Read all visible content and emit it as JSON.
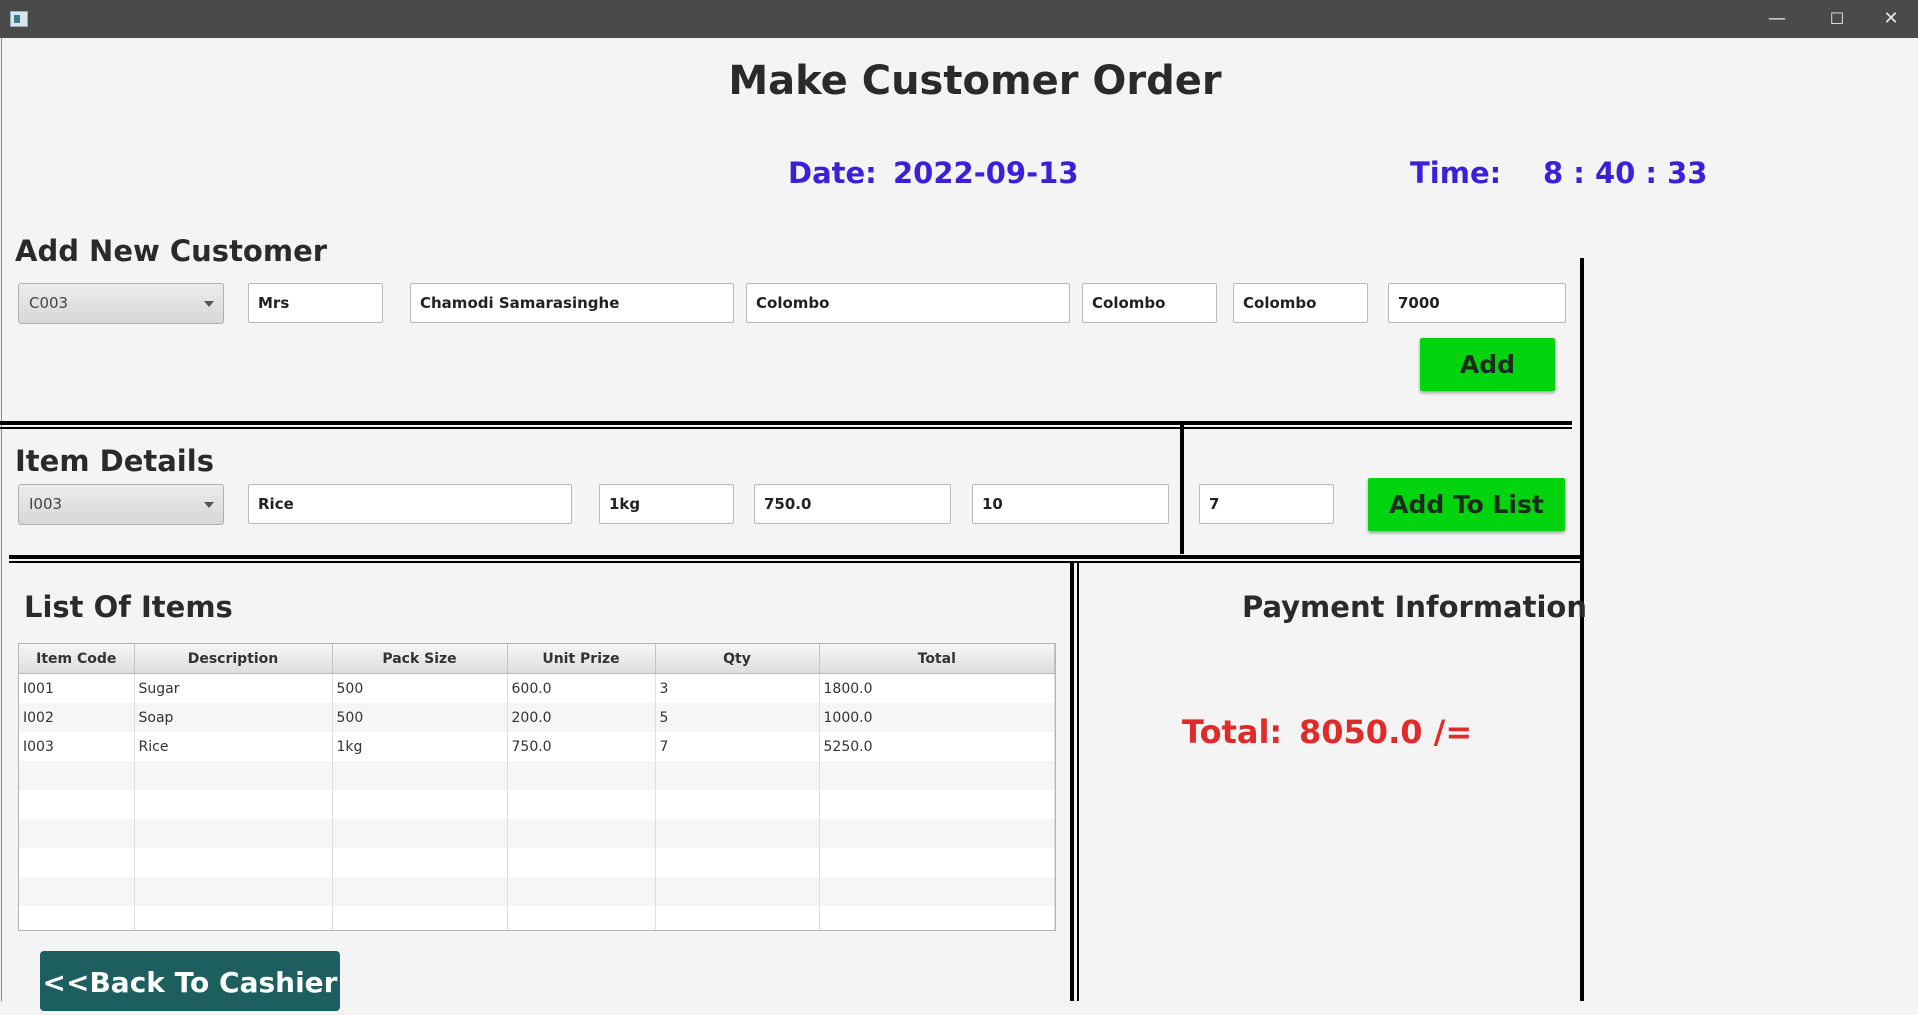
{
  "window": {
    "minimize_glyph": "—",
    "maximize_glyph": "☐",
    "close_glyph": "✕"
  },
  "page_title": "Make Customer Order",
  "date": {
    "label": "Date:",
    "value": "2022-09-13"
  },
  "time": {
    "label": "Time:",
    "value": "8 : 40 : 33"
  },
  "customer": {
    "heading": "Add New Customer",
    "id_selected": "C003",
    "title": "Mrs",
    "name": "Chamodi Samarasinghe",
    "address": "Colombo",
    "city": "Colombo",
    "province": "Colombo",
    "postal_code": "7000",
    "add_label": "Add"
  },
  "item": {
    "heading": "Item Details",
    "code_selected": "I003",
    "description": "Rice",
    "pack_size": "1kg",
    "unit_price": "750.0",
    "qty_on_hand": "10",
    "qty": "7",
    "add_to_list_label": "Add To List"
  },
  "list": {
    "heading": "List Of Items",
    "columns": [
      "Item Code",
      "Description",
      "Pack Size",
      "Unit Prize",
      "Qty",
      "Total"
    ],
    "rows": [
      [
        "I001",
        "Sugar",
        "500",
        "600.0",
        "3",
        "1800.0"
      ],
      [
        "I002",
        "Soap",
        "500",
        "200.0",
        "5",
        "1000.0"
      ],
      [
        "I003",
        "Rice",
        "1kg",
        "750.0",
        "7",
        "5250.0"
      ]
    ]
  },
  "payment": {
    "heading": "Payment Information",
    "total_label": "Total:",
    "total_value": "8050.0 /="
  },
  "back_button_label": "<<Back To Cashier",
  "colors": {
    "accent_blue": "#3c1fd8",
    "button_green": "#00d40f",
    "total_red": "#e02b2b",
    "back_button": "#1d5e5e"
  }
}
